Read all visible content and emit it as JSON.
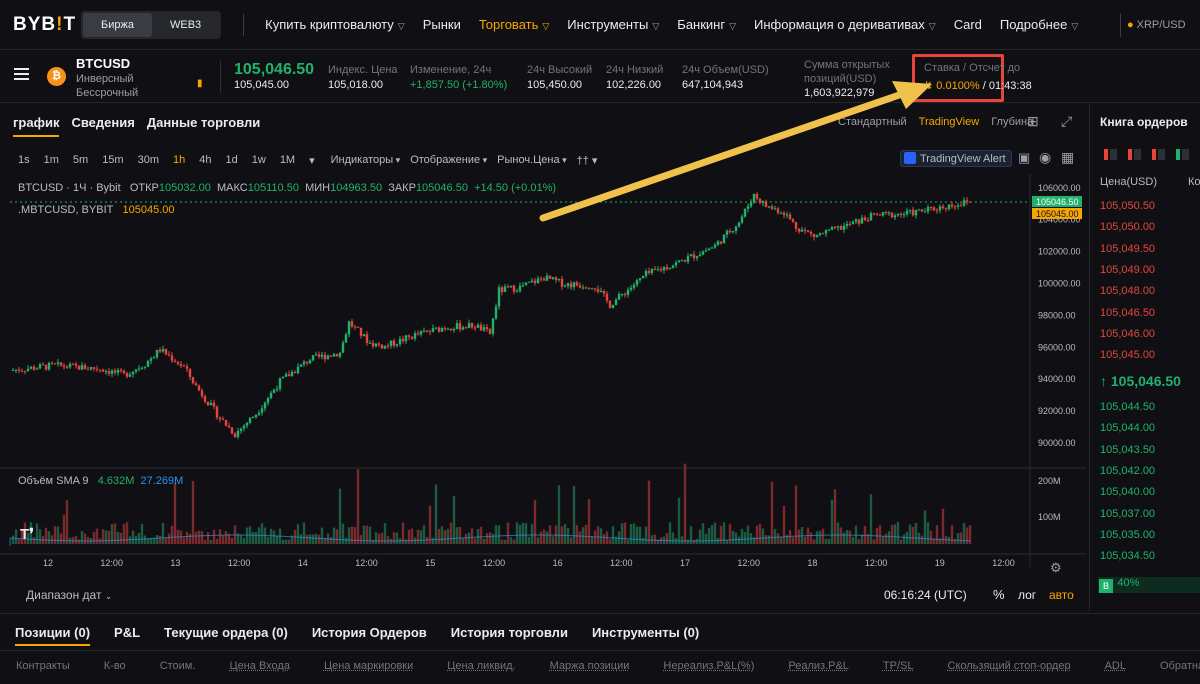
{
  "topnav": {
    "logo_left": "BYB",
    "logo_tick": "!",
    "logo_right": "T",
    "segments": [
      "Биржа",
      "WEB3"
    ],
    "menu": [
      {
        "label": "Купить криптовалюту",
        "chevron": true
      },
      {
        "label": "Рынки",
        "chevron": false
      },
      {
        "label": "Торговать",
        "chevron": true,
        "active": true
      },
      {
        "label": "Инструменты",
        "chevron": true
      },
      {
        "label": "Банкинг",
        "chevron": true
      },
      {
        "label": "Информация о деривативах",
        "chevron": true
      },
      {
        "label": "Card",
        "chevron": false
      },
      {
        "label": "Подробнее",
        "chevron": true
      }
    ],
    "ticker_right": "XRP/USD"
  },
  "ticker": {
    "symbol": "BTCUSD",
    "subtitle_1": "Инверсный",
    "subtitle_2": "Бессрочный",
    "last_price": "105,046.50",
    "mark_price": "105,045.00",
    "stats": [
      {
        "label": "Индекс. Цена",
        "value": "105,018.00",
        "green": false
      },
      {
        "label": "Изменение, 24ч",
        "value": "+1,857.50 (+1.80%)",
        "green": true
      },
      {
        "label": "24ч Высокий",
        "value": "105,450.00",
        "green": false
      },
      {
        "label": "24ч Низкий",
        "value": "102,226.00",
        "green": false
      },
      {
        "label": "24ч Объем(USD)",
        "value": "647,104,943",
        "green": false
      }
    ],
    "open_interest_label_1": "Сумма открытых",
    "open_interest_label_2": "позиций(USD)",
    "open_interest": "1,603,922,979",
    "funding_label": "Ставка / Отсчет до",
    "funding_rate": "0.0100%",
    "funding_countdown": "/ 01:43:38"
  },
  "panel": {
    "tabs": [
      "график",
      "Сведения",
      "Данные торговли"
    ],
    "view_tabs": [
      "Стандартный",
      "TradingView",
      "Глубина"
    ],
    "timeframes": [
      "1s",
      "1m",
      "5m",
      "15m",
      "30m",
      "1h",
      "4h",
      "1d",
      "1w",
      "1M"
    ],
    "active_timeframe": "1h",
    "dropdowns": [
      "Индикаторы",
      "Отображение",
      "Рыноч.Цена"
    ],
    "tv_alert": "TradingView Alert",
    "legend_main": "BTCUSD · 1Ч · Bybit",
    "legend_ohlc": [
      {
        "k": "ОТКР",
        "v": "105032.00"
      },
      {
        "k": "МАКС",
        "v": "105110.50"
      },
      {
        "k": "МИН",
        "v": "104963.50"
      },
      {
        "k": "ЗАКР",
        "v": "105046.50"
      }
    ],
    "legend_change": "+14.50 (+0.01%)",
    "legend_mark": ".MBTCUSD, BYBIT",
    "legend_mark_value": "105045.00",
    "volume_label": "Объём SMA 9",
    "volume_value": "4.632M",
    "volume_sma": "27.269M",
    "date_range": "Диапазон дат",
    "clock": "06:16:24 (UTC)",
    "pct": "%",
    "log": "лог",
    "auto": "авто"
  },
  "chart_data": {
    "type": "candlestick",
    "y_ticks": [
      106000,
      104000,
      102000,
      100000,
      98000,
      96000,
      94000,
      92000,
      90000
    ],
    "ylim": [
      88500,
      106800
    ],
    "x_ticks": [
      "12",
      "12:00",
      "13",
      "12:00",
      "14",
      "12:00",
      "15",
      "12:00",
      "16",
      "12:00",
      "17",
      "12:00",
      "18",
      "12:00",
      "19",
      "12:00"
    ],
    "vol_ticks": [
      "200M",
      "100M"
    ],
    "last_price_tag": "105046.50",
    "mark_price_tag": "105045.00",
    "close_path": [
      [
        0,
        94500
      ],
      [
        15,
        94800
      ],
      [
        30,
        94600
      ],
      [
        38,
        94200
      ],
      [
        45,
        94900
      ],
      [
        50,
        95800
      ],
      [
        58,
        94700
      ],
      [
        62,
        93500
      ],
      [
        70,
        91500
      ],
      [
        75,
        90500
      ],
      [
        82,
        91800
      ],
      [
        90,
        93800
      ],
      [
        100,
        95200
      ],
      [
        110,
        95600
      ],
      [
        113,
        97500
      ],
      [
        120,
        96200
      ],
      [
        125,
        96000
      ],
      [
        135,
        96700
      ],
      [
        145,
        97200
      ],
      [
        155,
        97300
      ],
      [
        160,
        96800
      ],
      [
        163,
        99500
      ],
      [
        170,
        99700
      ],
      [
        178,
        100300
      ],
      [
        185,
        99900
      ],
      [
        195,
        99800
      ],
      [
        200,
        98600
      ],
      [
        205,
        99400
      ],
      [
        212,
        100500
      ],
      [
        222,
        101200
      ],
      [
        228,
        101700
      ],
      [
        235,
        102300
      ],
      [
        243,
        103800
      ],
      [
        248,
        105500
      ],
      [
        252,
        104800
      ],
      [
        258,
        104400
      ],
      [
        262,
        103500
      ],
      [
        268,
        102900
      ],
      [
        278,
        103500
      ],
      [
        288,
        104200
      ],
      [
        298,
        104300
      ],
      [
        305,
        104500
      ],
      [
        315,
        104900
      ],
      [
        320,
        105046
      ]
    ]
  },
  "book": {
    "title": "Книга ордеров",
    "col_price": "Цена(USD)",
    "col_qty": "Ко",
    "asks": [
      "105,050.50",
      "105,050.00",
      "105,049.50",
      "105,049.00",
      "105,048.00",
      "105,046.50",
      "105,046.00",
      "105,045.00"
    ],
    "mid": "↑ 105,046.50",
    "bids": [
      "105,044.50",
      "105,044.00",
      "105,043.50",
      "105,042.00",
      "105,040.00",
      "105,037.00",
      "105,035.00",
      "105,034.50"
    ],
    "ratio_badge": "B",
    "ratio_value": "40%"
  },
  "bottom": {
    "tabs": [
      "Позиции (0)",
      "P&L",
      "Текущие ордера (0)",
      "История Ордеров",
      "История торговли",
      "Инструменты (0)"
    ],
    "columns": [
      "Контракты",
      "К-во",
      "Стоим.",
      "Цена Входа",
      "Цена маркировки",
      "Цена ликвид.",
      "Маржа позиции",
      "Нереализ.P&L(%)",
      "Реализ.P&L",
      "TP/SL",
      "Скользящий стоп-ордер",
      "ADL",
      "Обратная п"
    ]
  },
  "colors": {
    "up": "#20b26c",
    "down": "#e5453b",
    "accent": "#f7a600",
    "annotation": "#f0c24b",
    "highlight": "#e5453b"
  }
}
